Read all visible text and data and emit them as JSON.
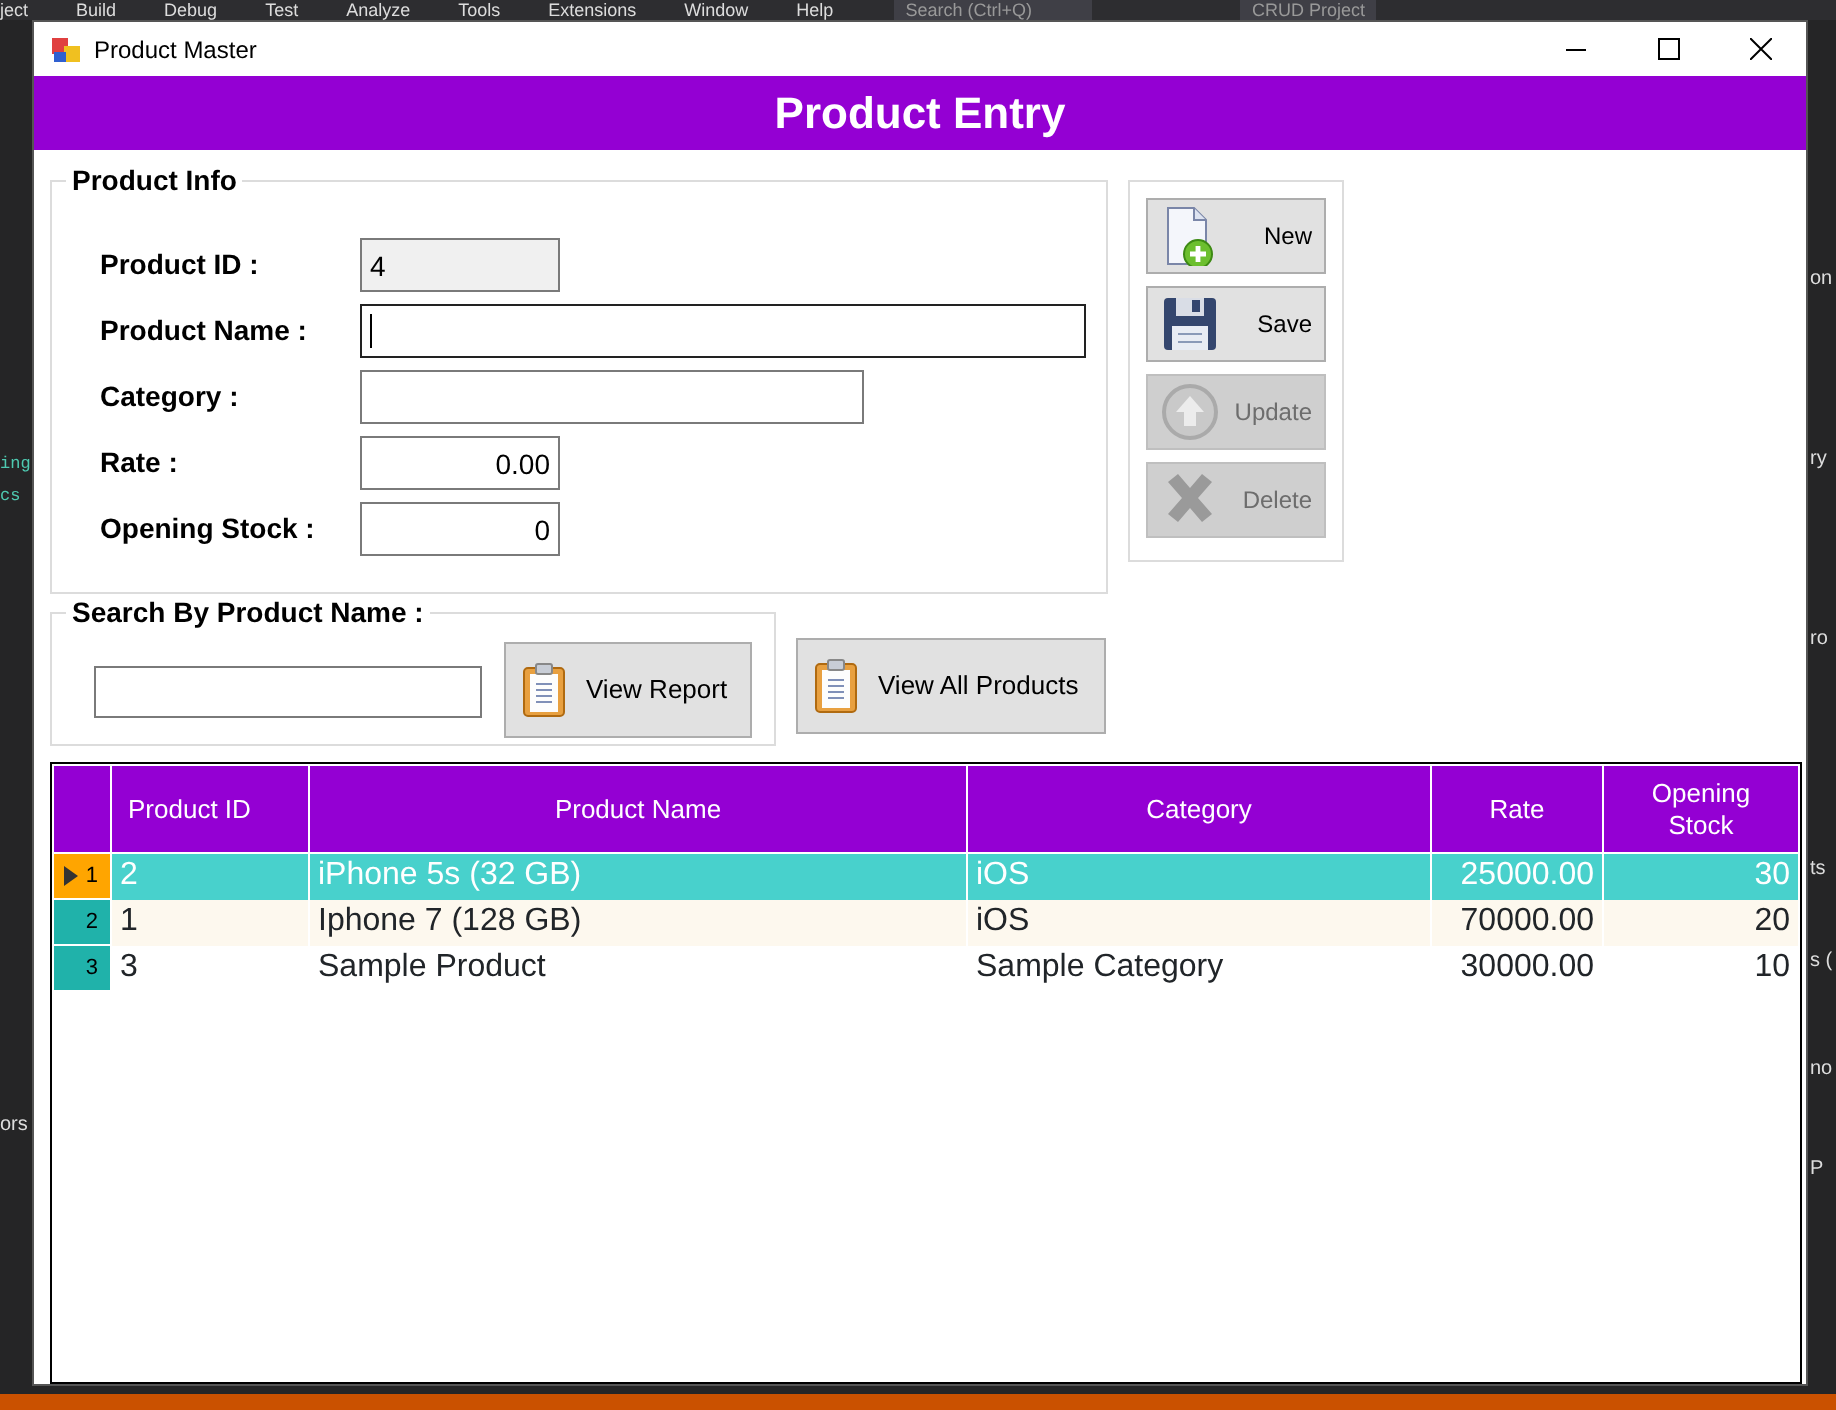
{
  "ide_background": {
    "menu": [
      "ject",
      "Build",
      "Debug",
      "Test",
      "Analyze",
      "Tools",
      "Extensions",
      "Window",
      "Help"
    ],
    "search": "Search (Ctrl+Q)",
    "project": "CRUD Project",
    "left_fragments": [
      {
        "text": "ing",
        "kind": "code"
      },
      {
        "text": "cs",
        "kind": "code"
      },
      {
        "text": "ors",
        "kind": "tab"
      }
    ],
    "right_fragments": [
      "on",
      "ry",
      "ro",
      "ts",
      "s (",
      "no",
      "P"
    ]
  },
  "window": {
    "title": "Product Master"
  },
  "header": "Product Entry",
  "product_info": {
    "title": "Product Info",
    "fields": [
      {
        "label": "Product ID :",
        "value": "4",
        "readonly": true,
        "focused": false
      },
      {
        "label": "Product  Name :",
        "readonly": false,
        "focused": true
      },
      {
        "label": "Category :",
        "readonly": false,
        "focused": false
      },
      {
        "label": "Rate :",
        "value": "0.00",
        "readonly": false,
        "focused": false
      },
      {
        "label": "Opening Stock :",
        "value": "0",
        "readonly": false,
        "focused": false
      }
    ]
  },
  "actions": [
    {
      "label": "New",
      "kind": "new",
      "disabled": false
    },
    {
      "label": "Save",
      "kind": "save",
      "disabled": false
    },
    {
      "label": "Update",
      "kind": "update",
      "disabled": true
    },
    {
      "label": "Delete",
      "kind": "delete",
      "disabled": true
    }
  ],
  "search": {
    "title": "Search By Product Name :",
    "button": "View Report"
  },
  "view_all_button": "View All Products",
  "grid": {
    "columns": [
      {
        "label": "Product ID"
      },
      {
        "label": "Product Name"
      },
      {
        "label": "Category"
      },
      {
        "label": "Rate"
      },
      {
        "label": "Opening Stock"
      }
    ],
    "rows": [
      {
        "number": "1",
        "selected": true,
        "cells": [
          "2",
          "iPhone 5s (32 GB)",
          "iOS",
          "25000.00",
          "30"
        ]
      },
      {
        "number": "2",
        "selected": false,
        "cells": [
          "1",
          "Iphone 7 (128 GB)",
          "iOS",
          "70000.00",
          "20"
        ]
      },
      {
        "number": "3",
        "selected": false,
        "cells": [
          "3",
          "Sample Product",
          "Sample Category",
          "30000.00",
          "10"
        ]
      }
    ]
  }
}
